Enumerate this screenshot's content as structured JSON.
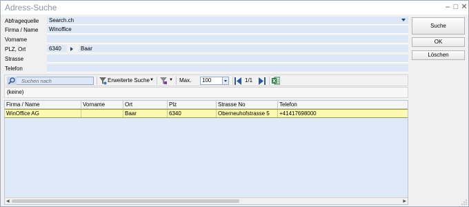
{
  "window": {
    "title": "Adress-Suche"
  },
  "form": {
    "fields": [
      {
        "label": "Abfragequelle",
        "value": "Search.ch"
      },
      {
        "label": "Firma / Name",
        "value": "Winoffice"
      },
      {
        "label": "Vorname",
        "value": ""
      },
      {
        "label": "PLZ, Ort",
        "plz": "6340",
        "ort": "Baar"
      },
      {
        "label": "Strasse",
        "value": ""
      },
      {
        "label": "Telefon",
        "value": ""
      }
    ]
  },
  "buttons": {
    "search": "Suche",
    "ok": "OK",
    "delete": "Löschen"
  },
  "toolbar": {
    "search_placeholder": "Suchen nach",
    "extended_search": "Erweiterte Suche",
    "max_label": "Max.",
    "max_value": "100",
    "page": "1/1"
  },
  "filter": {
    "text": "(keine)"
  },
  "grid": {
    "columns": [
      "Firma / Name",
      "Vorname",
      "Ort",
      "Plz",
      "Strasse No",
      "Telefon"
    ],
    "rows": [
      [
        "WinOffice AG",
        "",
        "Baar",
        "6340",
        "Oberneuhofstrasse 5",
        "+41417698000"
      ]
    ]
  },
  "colors": {
    "field_bg": "#dde8f7",
    "row_highlight": "#fbf8b0",
    "excel_green": "#1f7a3a"
  }
}
